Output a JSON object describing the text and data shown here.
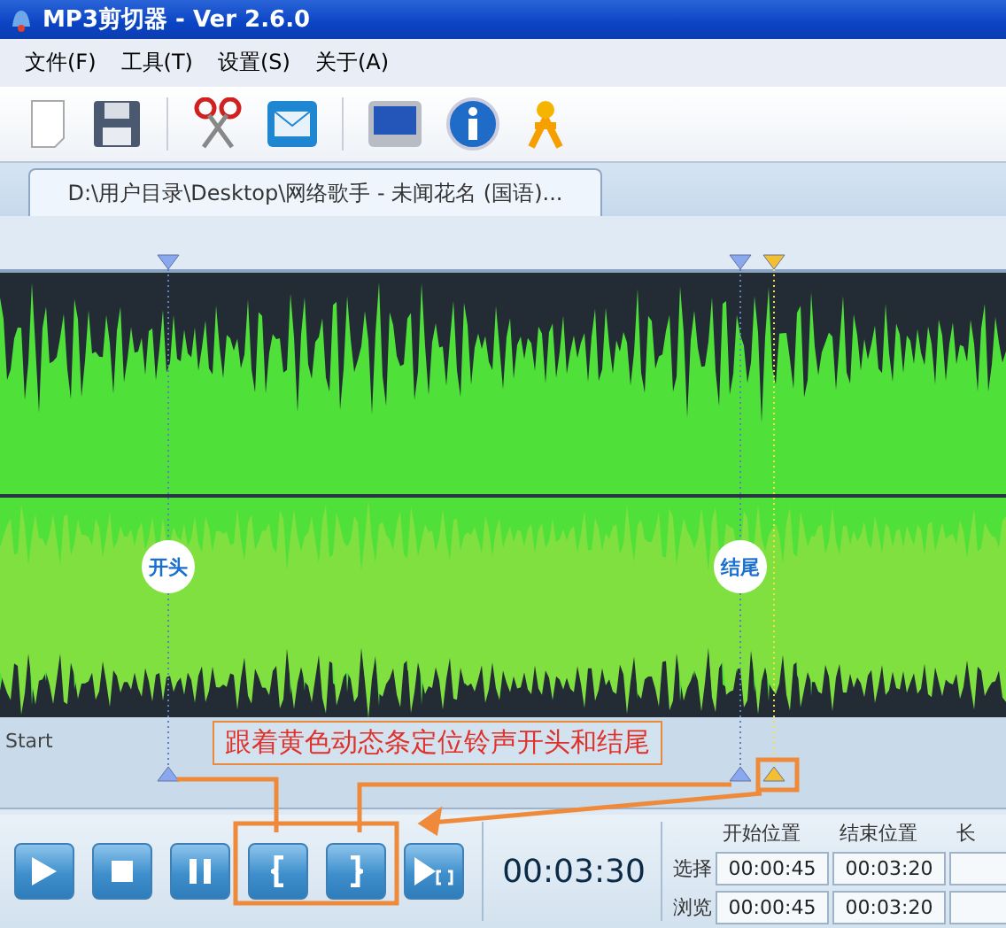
{
  "window": {
    "title": "MP3剪切器 - Ver 2.6.0"
  },
  "menu": [
    {
      "label": "文件(F)"
    },
    {
      "label": "工具(T)"
    },
    {
      "label": "设置(S)"
    },
    {
      "label": "关于(A)"
    }
  ],
  "tab": {
    "label": "D:\\用户目录\\Desktop\\网络歌手 - 未闻花名 (国语)...",
    "selected": true
  },
  "markers": {
    "start_label": "开头",
    "end_label": "结尾"
  },
  "timeline": {
    "label": "Start"
  },
  "annotation": "跟着黄色动态条定位铃声开头和结尾",
  "time": "00:03:30",
  "columns": [
    "开始位置",
    "结束位置",
    "长"
  ],
  "rows": [
    {
      "label": "选择",
      "values": [
        "00:00:45",
        "00:03:20"
      ]
    },
    {
      "label": "浏览",
      "values": [
        "00:00:45",
        "00:03:20"
      ]
    }
  ]
}
